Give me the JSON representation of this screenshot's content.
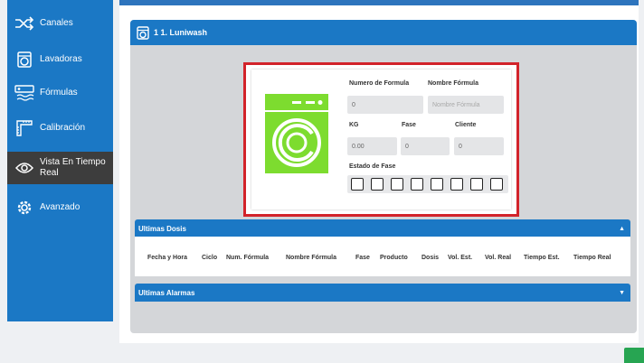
{
  "sidebar": {
    "items": [
      {
        "label": "Canales",
        "icon": "shuffle-icon"
      },
      {
        "label": "Lavadoras",
        "icon": "washer-icon"
      },
      {
        "label": "Fórmulas",
        "icon": "formula-icon"
      },
      {
        "label": "Calibración",
        "icon": "ruler-icon"
      },
      {
        "label": "Vista En Tiempo Real",
        "icon": "eye-icon",
        "active": true
      },
      {
        "label": "Avanzado",
        "icon": "gear-icon"
      }
    ]
  },
  "panel": {
    "title": "1 1. Luniwash"
  },
  "machine": {
    "numero_formula_label": "Numero de Formula",
    "numero_formula_value": "0",
    "nombre_formula_label": "Nombre Fórmula",
    "nombre_formula_placeholder": "Nombre Fórmula",
    "kg_label": "KG",
    "kg_value": "0.00",
    "fase_label": "Fase",
    "fase_value": "0",
    "cliente_label": "Cliente",
    "cliente_value": "0",
    "estado_fase_label": "Estado de Fase",
    "phase_count": 8,
    "washer_color": "#7ddc2f"
  },
  "ultimas_dosis": {
    "title": "Ultimas Dosis",
    "columns": [
      "Fecha y Hora",
      "Ciclo",
      "Num. Fórmula",
      "Nombre Fórmula",
      "Fase",
      "Producto",
      "Dosis",
      "Vol. Est.",
      "Vol. Real",
      "Tiempo Est.",
      "Tiempo Real"
    ]
  },
  "ultimas_alarmas": {
    "title": "Ultimas Alarmas"
  },
  "colors": {
    "accent": "#1b78c5",
    "active_item": "#3d3d3d",
    "highlight_border": "#d2232a"
  }
}
